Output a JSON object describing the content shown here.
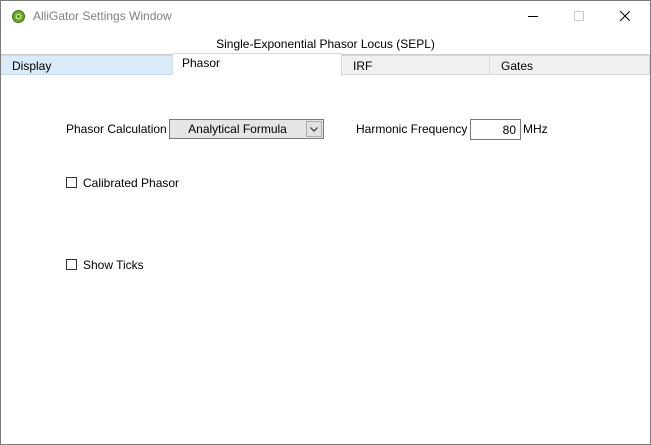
{
  "window": {
    "title": "AlliGator Settings Window",
    "accent_color": "#d9ebf9"
  },
  "header": {
    "subtitle": "Single-Exponential Phasor Locus (SEPL)"
  },
  "tabs": [
    {
      "label": "Display"
    },
    {
      "label": "Phasor"
    },
    {
      "label": "IRF"
    },
    {
      "label": "Gates"
    }
  ],
  "active_tab": "Phasor",
  "phasor": {
    "calculation_label": "Phasor Calculation",
    "calculation_value": "Analytical Formula",
    "harmonic_label": "Harmonic Frequency",
    "harmonic_value": "80",
    "harmonic_unit": "MHz",
    "calibrated_label": "Calibrated Phasor",
    "calibrated_checked": false,
    "show_ticks_label": "Show Ticks",
    "show_ticks_checked": false
  },
  "icons": {
    "app": "alligator-logo-icon",
    "minimize": "minimize-icon",
    "maximize": "maximize-icon",
    "close": "close-icon",
    "dropdown": "chevron-down-icon"
  }
}
